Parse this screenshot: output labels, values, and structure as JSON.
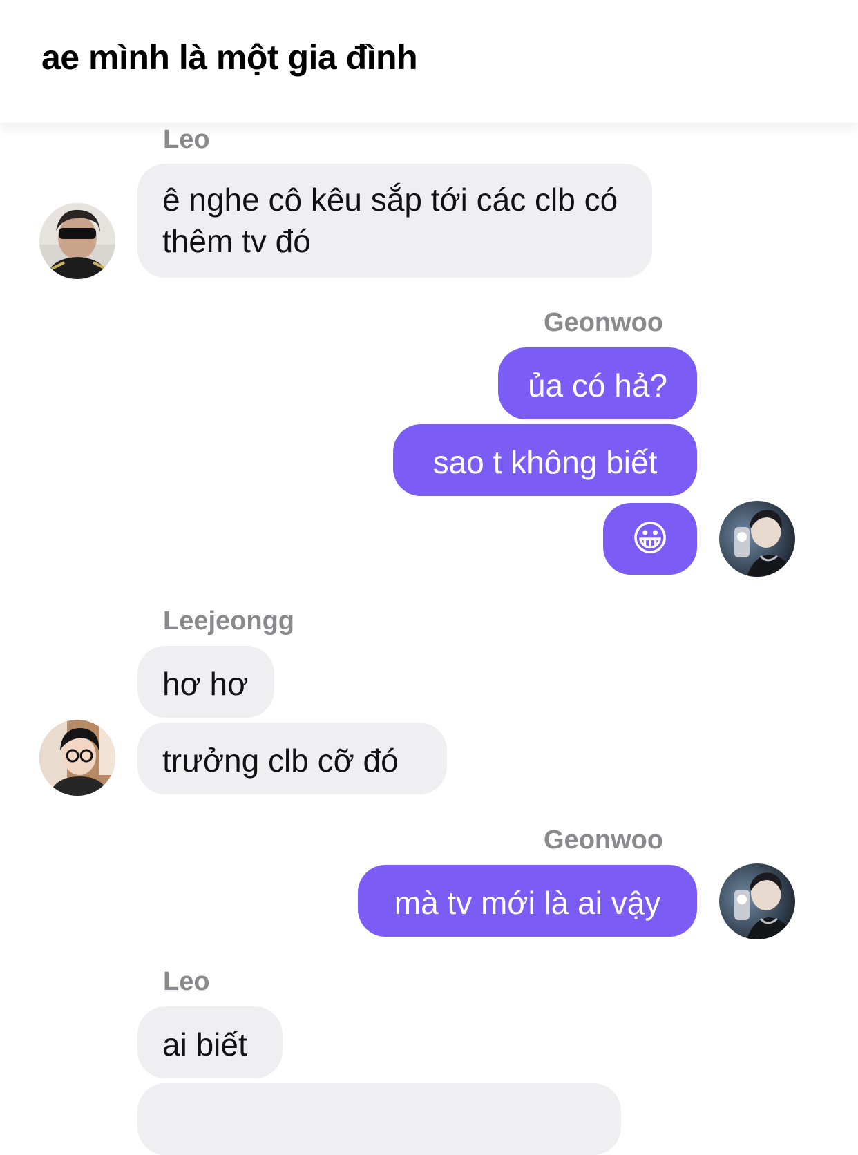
{
  "chat": {
    "title": "ae mình là một gia đình"
  },
  "messages": {
    "group1": {
      "sender": "Leo",
      "text": "ê nghe cô kêu sắp tới các clb có thêm tv đó"
    },
    "group2": {
      "sender": "Geonwoo",
      "texts": [
        "ủa có hả?",
        "sao t không biết",
        "😀"
      ]
    },
    "group3": {
      "sender": "Leejeongg",
      "texts": [
        "hơ hơ",
        "trưởng clb cỡ đó"
      ]
    },
    "group4": {
      "sender": "Geonwoo",
      "text": "mà tv mới là ai vậy"
    },
    "group5": {
      "sender": "Leo",
      "text": "ai biết"
    }
  },
  "colors": {
    "outgoing_bubble": "#7b5cf5",
    "incoming_bubble": "#efeff1",
    "sender_name": "#8a8a8e"
  },
  "icons": [
    "avatar-leo",
    "avatar-geonwoo",
    "avatar-leejeongg",
    "grinning-face-emoji"
  ]
}
